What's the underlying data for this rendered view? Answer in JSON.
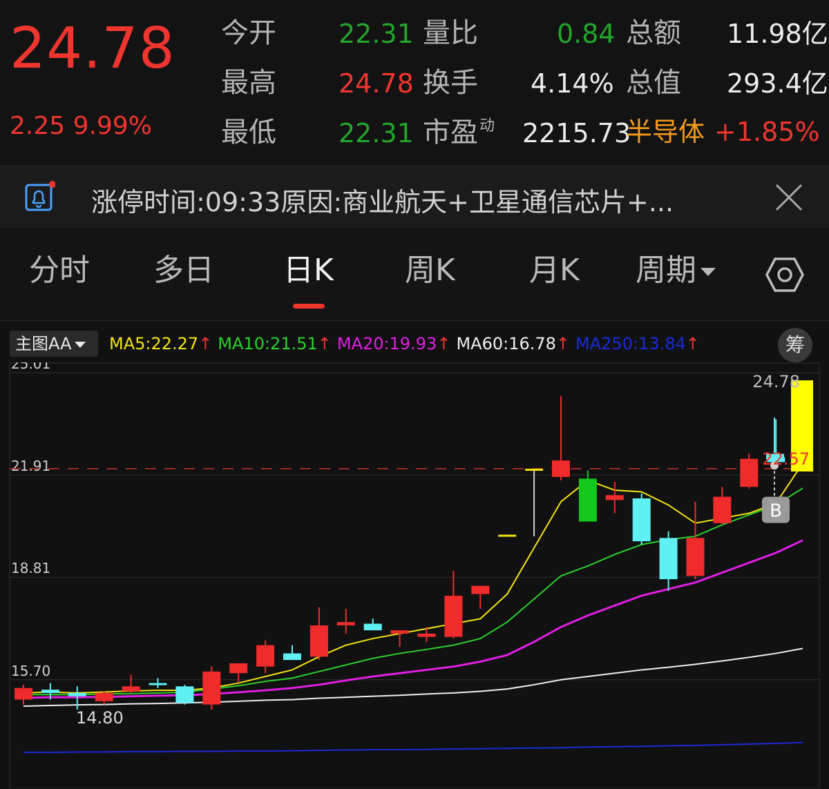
{
  "quote": {
    "price": "24.78",
    "change": "2.25",
    "change_pct": "9.99%",
    "stats": [
      {
        "label": "今开",
        "value": "22.31",
        "color": "#23a52b"
      },
      {
        "label": "量比",
        "value": "0.84",
        "color": "#23a52b"
      },
      {
        "label": "总额",
        "value": "11.98亿",
        "color": "#ececec"
      },
      {
        "label": "最高",
        "value": "24.78",
        "color": "#f0352f"
      },
      {
        "label": "换手",
        "value": "4.14%",
        "color": "#ececec"
      },
      {
        "label": "总值",
        "value": "293.4亿",
        "color": "#ececec"
      },
      {
        "label": "最低",
        "value": "22.31",
        "color": "#23a52b"
      },
      {
        "label": "市盈",
        "sup": "动",
        "value": "2215.73",
        "color": "#ececec"
      }
    ],
    "sector": {
      "name": "半导体",
      "change": "+1.85%"
    }
  },
  "notice": {
    "text": "涨停时间:09:33原因:商业航天+卫星通信芯片+...",
    "bell_icon": "bell-icon",
    "close_icon": "close-icon"
  },
  "tabs": [
    {
      "label": "分时",
      "active": false
    },
    {
      "label": "多日",
      "active": false
    },
    {
      "label": "日K",
      "active": true
    },
    {
      "label": "周K",
      "active": false
    },
    {
      "label": "月K",
      "active": false
    },
    {
      "label": "周期",
      "active": false,
      "dropdown": true
    }
  ],
  "settings_icon": "hexagon-settings-icon",
  "chart_bar": {
    "main_selector": "主图AA",
    "chip_button": "筹",
    "ma": [
      {
        "label": "MA5:",
        "value": "22.27",
        "color": "#f4e312"
      },
      {
        "label": "MA10:",
        "value": "21.51",
        "color": "#2bd12b"
      },
      {
        "label": "MA20:",
        "value": "19.93",
        "color": "#e11ee4"
      },
      {
        "label": "MA60:",
        "value": "16.78",
        "color": "#f0f0f0"
      },
      {
        "label": "MA250:",
        "value": "13.84",
        "color": "#1a2bd6"
      }
    ],
    "arrow": "↑"
  },
  "chart_data": {
    "type": "candlestick",
    "y_ticks": [
      "25.01",
      "21.91",
      "18.81",
      "15.70"
    ],
    "ylim": [
      12.8,
      25.01
    ],
    "candles": [
      {
        "o": 15.1,
        "h": 15.55,
        "l": 14.95,
        "c": 15.45,
        "kind": "up"
      },
      {
        "o": 15.4,
        "h": 15.6,
        "l": 15.1,
        "c": 15.3,
        "kind": "down-cyan"
      },
      {
        "o": 15.3,
        "h": 15.5,
        "l": 14.8,
        "c": 15.2,
        "kind": "down-cyan"
      },
      {
        "o": 15.05,
        "h": 15.35,
        "l": 14.95,
        "c": 15.3,
        "kind": "up"
      },
      {
        "o": 15.35,
        "h": 15.85,
        "l": 15.3,
        "c": 15.5,
        "kind": "up"
      },
      {
        "o": 15.6,
        "h": 15.75,
        "l": 15.45,
        "c": 15.55,
        "kind": "down-cyan"
      },
      {
        "o": 15.5,
        "h": 15.55,
        "l": 14.95,
        "c": 15.0,
        "kind": "down-cyan"
      },
      {
        "o": 14.95,
        "h": 16.1,
        "l": 14.8,
        "c": 15.95,
        "kind": "up"
      },
      {
        "o": 15.9,
        "h": 16.05,
        "l": 15.6,
        "c": 16.2,
        "kind": "up"
      },
      {
        "o": 16.1,
        "h": 16.9,
        "l": 15.9,
        "c": 16.75,
        "kind": "up"
      },
      {
        "o": 16.5,
        "h": 16.75,
        "l": 16.35,
        "c": 16.3,
        "kind": "down-cyan"
      },
      {
        "o": 16.4,
        "h": 17.9,
        "l": 16.3,
        "c": 17.35,
        "kind": "up"
      },
      {
        "o": 17.45,
        "h": 17.85,
        "l": 17.1,
        "c": 17.35,
        "kind": "up"
      },
      {
        "o": 17.4,
        "h": 17.55,
        "l": 17.2,
        "c": 17.2,
        "kind": "down-cyan"
      },
      {
        "o": 17.1,
        "h": 17.2,
        "l": 16.7,
        "c": 17.2,
        "kind": "up"
      },
      {
        "o": 17.0,
        "h": 17.3,
        "l": 16.85,
        "c": 17.1,
        "kind": "up"
      },
      {
        "o": 17.0,
        "h": 19.0,
        "l": 16.95,
        "c": 18.25,
        "kind": "up"
      },
      {
        "o": 18.3,
        "h": 18.55,
        "l": 17.85,
        "c": 18.55,
        "kind": "up"
      },
      {
        "o": 20.1,
        "h": 20.1,
        "l": 20.05,
        "c": 20.05,
        "kind": "flat"
      },
      {
        "o": 22.1,
        "h": 22.1,
        "l": 20.05,
        "c": 22.05,
        "kind": "flat"
      },
      {
        "o": 21.85,
        "h": 24.3,
        "l": 21.75,
        "c": 22.35,
        "kind": "up"
      },
      {
        "o": 21.8,
        "h": 22.05,
        "l": 20.5,
        "c": 20.5,
        "kind": "down-green"
      },
      {
        "o": 21.3,
        "h": 21.7,
        "l": 20.75,
        "c": 21.15,
        "kind": "up"
      },
      {
        "o": 21.2,
        "h": 21.35,
        "l": 19.8,
        "c": 19.9,
        "kind": "down-cyan"
      },
      {
        "o": 20.0,
        "h": 20.2,
        "l": 18.4,
        "c": 18.75,
        "kind": "down-cyan"
      },
      {
        "o": 18.85,
        "h": 21.1,
        "l": 18.75,
        "c": 20.0,
        "kind": "up"
      },
      {
        "o": 20.45,
        "h": 21.55,
        "l": 20.4,
        "c": 21.25,
        "kind": "up"
      },
      {
        "o": 21.55,
        "h": 22.55,
        "l": 21.5,
        "c": 22.4,
        "kind": "up"
      },
      {
        "o": 22.45,
        "h": 23.6,
        "l": 22.3,
        "c": 22.3,
        "kind": "down-cyan"
      },
      {
        "o": 22.5,
        "h": 24.78,
        "l": 22.31,
        "c": 24.78,
        "kind": "highlight"
      }
    ],
    "ma5": [
      15.3,
      15.33,
      15.3,
      15.33,
      15.36,
      15.38,
      15.38,
      15.45,
      15.6,
      15.8,
      16.0,
      16.4,
      16.75,
      16.95,
      17.1,
      17.25,
      17.4,
      17.55,
      18.3,
      19.7,
      21.1,
      21.75,
      21.45,
      21.4,
      21.0,
      20.45,
      20.6,
      20.75,
      21.05,
      22.27
    ],
    "ma10": [
      15.25,
      15.25,
      15.25,
      15.27,
      15.28,
      15.3,
      15.32,
      15.42,
      15.52,
      15.65,
      15.75,
      15.95,
      16.15,
      16.35,
      16.5,
      16.62,
      16.75,
      16.95,
      17.45,
      18.15,
      18.85,
      19.15,
      19.5,
      19.8,
      19.95,
      20.05,
      20.4,
      20.7,
      21.0,
      21.51
    ],
    "ma20": [
      15.15,
      15.17,
      15.17,
      15.18,
      15.2,
      15.22,
      15.23,
      15.27,
      15.32,
      15.38,
      15.45,
      15.55,
      15.68,
      15.8,
      15.9,
      16.0,
      16.1,
      16.25,
      16.45,
      16.85,
      17.3,
      17.65,
      17.95,
      18.25,
      18.45,
      18.65,
      18.95,
      19.25,
      19.55,
      19.93
    ],
    "ma60": [
      14.9,
      14.92,
      14.94,
      14.95,
      14.97,
      14.98,
      15.0,
      15.02,
      15.05,
      15.08,
      15.1,
      15.14,
      15.17,
      15.2,
      15.23,
      15.27,
      15.3,
      15.35,
      15.42,
      15.55,
      15.7,
      15.8,
      15.9,
      16.0,
      16.08,
      16.17,
      16.27,
      16.38,
      16.5,
      16.65
    ],
    "ma250": [
      13.5,
      13.5,
      13.51,
      13.51,
      13.52,
      13.52,
      13.53,
      13.53,
      13.54,
      13.54,
      13.55,
      13.56,
      13.57,
      13.58,
      13.58,
      13.59,
      13.6,
      13.61,
      13.62,
      13.63,
      13.64,
      13.66,
      13.67,
      13.68,
      13.7,
      13.71,
      13.73,
      13.75,
      13.77,
      13.8
    ],
    "ref_line": 22.31,
    "labels": {
      "high": "24.78",
      "low": "14.80",
      "ref": "22.57",
      "buy_marker": "B"
    }
  }
}
